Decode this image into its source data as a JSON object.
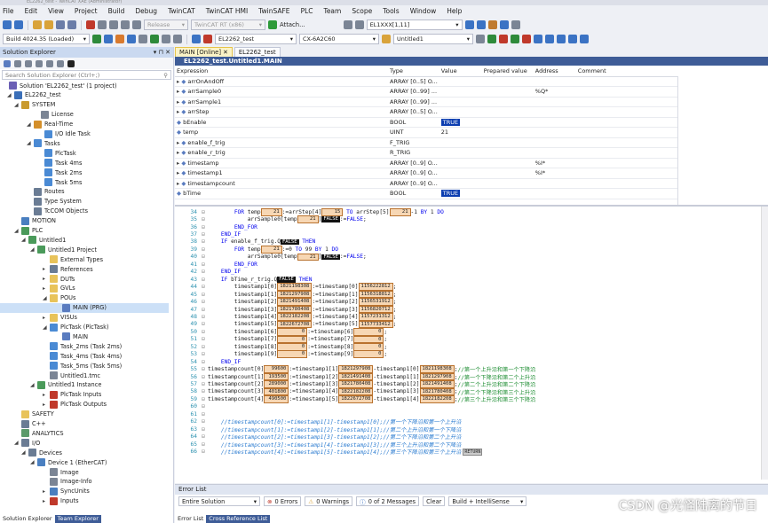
{
  "menu": [
    "File",
    "Edit",
    "View",
    "Project",
    "Build",
    "Debug",
    "TwinCAT",
    "TwinCAT HMI",
    "TwinSAFE",
    "PLC",
    "Team",
    "Scope",
    "Tools",
    "Window",
    "Help"
  ],
  "toolbar1": {
    "release": "Release",
    "platform": "TwinCAT RT (x86)",
    "attach": "Attach...",
    "el": "EL1XXX[1,11]"
  },
  "toolbar2": {
    "build": "Build 4024.35 (Loaded)",
    "project": "EL2262_test",
    "target": "CX-6A2C60",
    "instance": "Untitled1"
  },
  "solution_explorer": {
    "title": "Solution Explorer",
    "search_placeholder": "Search Solution Explorer (Ctrl+;)",
    "tabs": [
      "Solution Explorer",
      "Team Explorer"
    ],
    "nodes": [
      {
        "label": "Solution 'EL2262_test' (1 project)",
        "color": "#6b5fb5"
      },
      {
        "label": "EL2262_test",
        "color": "#3b6fb8"
      },
      {
        "label": "SYSTEM",
        "color": "#c99a2e"
      },
      {
        "label": "License",
        "color": "#7b8595"
      },
      {
        "label": "Real-Time",
        "color": "#d48f2a"
      },
      {
        "label": "I/O Idle Task",
        "color": "#4a8ad4"
      },
      {
        "label": "Tasks",
        "color": "#4a8ad4"
      },
      {
        "label": "PlcTask",
        "color": "#4a8ad4"
      },
      {
        "label": "Task 4ms",
        "color": "#4a8ad4"
      },
      {
        "label": "Task 2ms",
        "color": "#4a8ad4"
      },
      {
        "label": "Task 5ms",
        "color": "#4a8ad4"
      },
      {
        "label": "Routes",
        "color": "#6a7c94"
      },
      {
        "label": "Type System",
        "color": "#6a7c94"
      },
      {
        "label": "TcCOM Objects",
        "color": "#6a7c94"
      },
      {
        "label": "MOTION",
        "color": "#4a7fc0"
      },
      {
        "label": "PLC",
        "color": "#4a9a5a"
      },
      {
        "label": "Untitled1",
        "color": "#4a9a5a"
      },
      {
        "label": "Untitled1 Project",
        "color": "#4a9a5a"
      },
      {
        "label": "External Types",
        "color": "#e8c35a"
      },
      {
        "label": "References",
        "color": "#6a7c94"
      },
      {
        "label": "DUTs",
        "color": "#e8c35a"
      },
      {
        "label": "GVLs",
        "color": "#e8c35a"
      },
      {
        "label": "POUs",
        "color": "#e8c35a"
      },
      {
        "label": "MAIN (PRG)",
        "color": "#5a7cc0"
      },
      {
        "label": "VISUs",
        "color": "#e8c35a"
      },
      {
        "label": "PlcTask (PlcTask)",
        "color": "#4a8ad4"
      },
      {
        "label": "MAIN",
        "color": "#5a7cc0"
      },
      {
        "label": "Task_2ms (Task 2ms)",
        "color": "#4a8ad4"
      },
      {
        "label": "Task_4ms (Task 4ms)",
        "color": "#4a8ad4"
      },
      {
        "label": "Task_5ms (Task 5ms)",
        "color": "#4a8ad4"
      },
      {
        "label": "Untitled1.tmc",
        "color": "#7b8595"
      },
      {
        "label": "Untitled1 Instance",
        "color": "#4a9a5a"
      },
      {
        "label": "PlcTask Inputs",
        "color": "#c0392b"
      },
      {
        "label": "PlcTask Outputs",
        "color": "#c0392b"
      },
      {
        "label": "SAFETY",
        "color": "#e8c35a"
      },
      {
        "label": "C++",
        "color": "#6a7c94"
      },
      {
        "label": "ANALYTICS",
        "color": "#5a9a6a"
      },
      {
        "label": "I/O",
        "color": "#6a7c94"
      },
      {
        "label": "Devices",
        "color": "#6a7c94"
      },
      {
        "label": "Device 1 (EtherCAT)",
        "color": "#4a7fc0"
      },
      {
        "label": "Image",
        "color": "#7b8595"
      },
      {
        "label": "Image-Info",
        "color": "#7b8595"
      },
      {
        "label": "SyncUnits",
        "color": "#4a7fc0"
      },
      {
        "label": "Inputs",
        "color": "#c0392b"
      }
    ]
  },
  "doc_tabs": [
    "MAIN [Online]",
    "EL2262_test"
  ],
  "doc_title": "EL2262_test.Untitled1.MAIN",
  "watch": {
    "headers": [
      "Expression",
      "Type",
      "Value",
      "Prepared value",
      "Address",
      "Comment"
    ],
    "rows": [
      {
        "expr": "arrOnAndOff",
        "type": "ARRAY [0..5] O...",
        "value": "",
        "address": ""
      },
      {
        "expr": "arrSample0",
        "type": "ARRAY [0..99] ...",
        "value": "",
        "address": "%Q*"
      },
      {
        "expr": "arrSample1",
        "type": "ARRAY [0..99] ...",
        "value": "",
        "address": ""
      },
      {
        "expr": "arrStep",
        "type": "ARRAY [0..5] O...",
        "value": "",
        "address": ""
      },
      {
        "expr": "bEnable",
        "type": "BOOL",
        "value": "TRUE",
        "address": ""
      },
      {
        "expr": "temp",
        "type": "UINT",
        "value": "21",
        "address": ""
      },
      {
        "expr": "enable_f_trig",
        "type": "F_TRIG",
        "value": "",
        "address": ""
      },
      {
        "expr": "enable_r_trig",
        "type": "R_TRIG",
        "value": "",
        "address": ""
      },
      {
        "expr": "timestamp",
        "type": "ARRAY [0..9] O...",
        "value": "",
        "address": "%I*"
      },
      {
        "expr": "timestamp1",
        "type": "ARRAY [0..9] O...",
        "value": "",
        "address": "%I*"
      },
      {
        "expr": "timestampcount",
        "type": "ARRAY [0..9] O...",
        "value": "",
        "address": ""
      },
      {
        "expr": "bTime",
        "type": "BOOL",
        "value": "TRUE",
        "address": ""
      }
    ]
  },
  "code": {
    "lines": [
      {
        "n": "34",
        "t": "    FOR temp[21]:=arrStep[4][15] TO arrStep[5][21]-1 BY 1 DO"
      },
      {
        "n": "35",
        "t": "        arrSample0[temp[21]]FALSE:=FALSE;"
      },
      {
        "n": "36",
        "t": "    END_FOR"
      },
      {
        "n": "37",
        "t": "END_IF"
      },
      {
        "n": "38",
        "t": "IF enable_f_trig.QFALSE THEN"
      },
      {
        "n": "39",
        "t": "    FOR temp[21]:=0 TO 99 BY 1 DO"
      },
      {
        "n": "40",
        "t": "        arrSample0[temp[21]]FALSE:=FALSE;"
      },
      {
        "n": "41",
        "t": "    END_FOR"
      },
      {
        "n": "42",
        "t": "END_IF"
      },
      {
        "n": "43",
        "t": "IF bTime_r_trig.QFALSE THEN"
      }
    ],
    "ts_lines": [
      {
        "n": "44",
        "i": "0",
        "a": "1821198308",
        "b": "1156222812"
      },
      {
        "n": "45",
        "i": "1",
        "a": "1821297908",
        "b": "1156318812"
      },
      {
        "n": "46",
        "i": "2",
        "a": "1821491408",
        "b": "1156531912"
      },
      {
        "n": "47",
        "i": "3",
        "a": "1821780408",
        "b": "1156820712"
      },
      {
        "n": "48",
        "i": "4",
        "a": "1822182208",
        "b": "1157231312"
      },
      {
        "n": "49",
        "i": "5",
        "a": "1822672708",
        "b": "1157733412"
      },
      {
        "n": "50",
        "i": "6",
        "a": "0",
        "b": "0"
      },
      {
        "n": "51",
        "i": "7",
        "a": "0",
        "b": "0"
      },
      {
        "n": "52",
        "i": "8",
        "a": "0",
        "b": "0"
      },
      {
        "n": "53",
        "i": "9",
        "a": "0",
        "b": "0"
      }
    ],
    "end54": "END_IF",
    "cnt_lines": [
      {
        "n": "55",
        "i": "0",
        "v": "99600",
        "a": "1",
        "av": "1821297908",
        "b": "0",
        "bv": "1821198308",
        "c": "//第一个上升沿和第一个下降沿"
      },
      {
        "n": "56",
        "i": "1",
        "v": "193500",
        "a": "2",
        "av": "1821491408",
        "b": "1",
        "bv": "1821297908",
        "c": "//第一个下降沿和第二个上升沿"
      },
      {
        "n": "57",
        "i": "2",
        "v": "289000",
        "a": "3",
        "av": "1821780408",
        "b": "2",
        "bv": "1821491408",
        "c": "//第二个上升沿和第二个下降沿"
      },
      {
        "n": "58",
        "i": "3",
        "v": "401800",
        "a": "4",
        "av": "1822182208",
        "b": "3",
        "bv": "1821780408",
        "c": "//第二个下降沿和第三个上升沿"
      },
      {
        "n": "59",
        "i": "4",
        "v": "490500",
        "a": "5",
        "av": "1822672708",
        "b": "4",
        "bv": "1822182208",
        "c": "//第三个上升沿和第三个下降沿"
      }
    ],
    "blank_nums": [
      "60",
      "61"
    ],
    "comment_lines": [
      {
        "n": "62",
        "t": "//timestampcount[0]:=timestamp1[1]-timestamp1[0];//第一个下降沿和第一个上升沿"
      },
      {
        "n": "63",
        "t": "//timestampcount[1]:=timestamp1[2]-timestamp1[1];//第二个上升沿和第一个下降沿"
      },
      {
        "n": "64",
        "t": "//timestampcount[2]:=timestamp1[3]-timestamp1[2];//第二个下降沿和第二个上升沿"
      },
      {
        "n": "65",
        "t": "//timestampcount[3]:=timestamp1[4]-timestamp1[3];//第三个上升沿和第二个下降沿"
      },
      {
        "n": "66",
        "t": "//timestampcount[4]:=timestamp1[5]-timestamp1[4];//第三个下降沿和第三个上升沿"
      }
    ],
    "return_label": "RETURN"
  },
  "error_list": {
    "title": "Error List",
    "scope": "Entire Solution",
    "errors": "0 Errors",
    "warnings": "0 Warnings",
    "messages": "0 of 2 Messages",
    "clear": "Clear",
    "build": "Build + IntelliSense",
    "tabs": [
      "Error List",
      "Cross Reference List"
    ]
  },
  "watermark": "CSDN @光怪陆离的节日"
}
